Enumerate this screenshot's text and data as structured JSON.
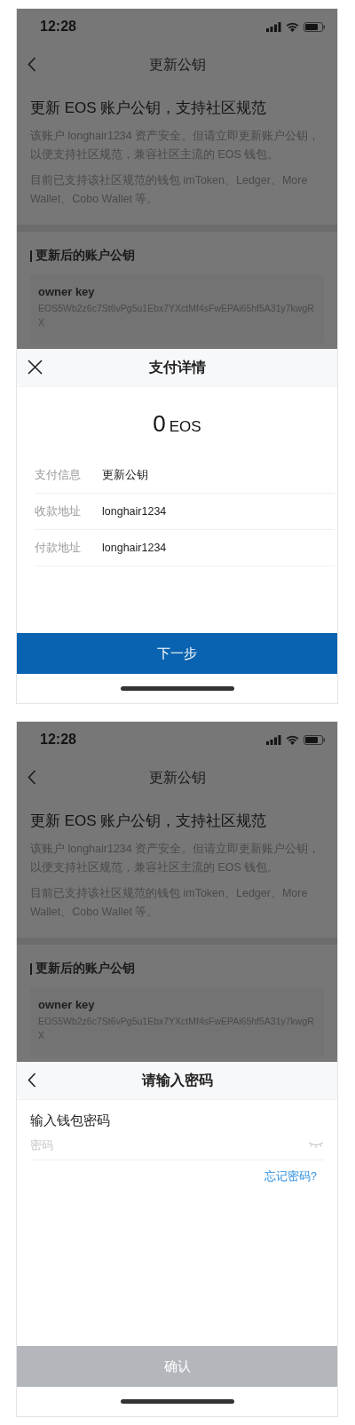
{
  "screens": [
    {
      "status_bar": {
        "time": "12:28"
      },
      "nav": {
        "title": "更新公钥"
      },
      "content": {
        "headline": "更新 EOS 账户公钥，支持社区规范",
        "paragraphs": [
          "该账户 longhair1234 资产安全。但请立即更新账户公钥，以便支持社区规范，兼容社区主流的 EOS 钱包。",
          "目前已支持该社区规范的钱包 imToken、Ledger、More Wallet、Cobo Wallet 等。"
        ],
        "section_title": "更新后的账户公钥",
        "key_label": "owner key",
        "key_value": "EOS5Wb2z6c7St6vPg5u1Ebx7YXctMf4sFwEPAi65hf5A31y7kwgRX"
      },
      "sheet": {
        "kind": "payment",
        "title": "支付详情",
        "amount": "0",
        "unit": "EOS",
        "rows": [
          {
            "label": "支付信息",
            "value": "更新公钥"
          },
          {
            "label": "收款地址",
            "value": "longhair1234"
          },
          {
            "label": "付款地址",
            "value": "longhair1234"
          }
        ],
        "button": {
          "label": "下一步",
          "disabled": false
        }
      }
    },
    {
      "status_bar": {
        "time": "12:28"
      },
      "nav": {
        "title": "更新公钥"
      },
      "content": {
        "headline": "更新 EOS 账户公钥，支持社区规范",
        "paragraphs": [
          "该账户 longhair1234 资产安全。但请立即更新账户公钥，以便支持社区规范，兼容社区主流的 EOS 钱包。",
          "目前已支持该社区规范的钱包 imToken、Ledger、More Wallet、Cobo Wallet 等。"
        ],
        "section_title": "更新后的账户公钥",
        "key_label": "owner key",
        "key_value": "EOS5Wb2z6c7St6vPg5u1Ebx7YXctMf4sFwEPAi65hf5A31y7kwgRX"
      },
      "sheet": {
        "kind": "password",
        "title": "请输入密码",
        "field_label": "输入钱包密码",
        "placeholder": "密码",
        "link": "忘记密码?",
        "button": {
          "label": "确认",
          "disabled": true
        }
      }
    }
  ]
}
